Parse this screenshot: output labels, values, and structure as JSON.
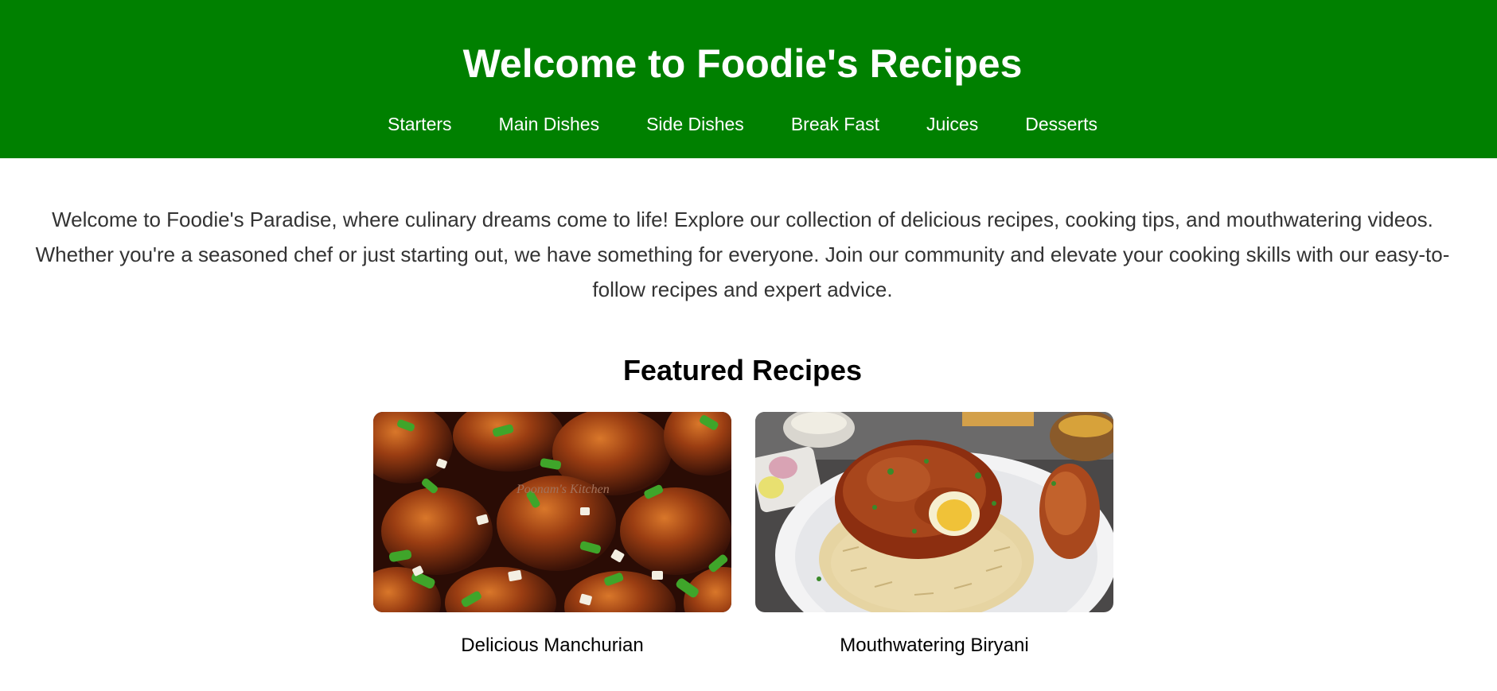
{
  "header": {
    "title": "Welcome to Foodie's Recipes",
    "background_color": "#008000",
    "nav": [
      {
        "label": "Starters"
      },
      {
        "label": "Main Dishes"
      },
      {
        "label": "Side Dishes"
      },
      {
        "label": "Break Fast"
      },
      {
        "label": "Juices"
      },
      {
        "label": "Desserts"
      }
    ]
  },
  "intro": {
    "text": "Welcome to Foodie's Paradise, where culinary dreams come to life! Explore our collection of delicious recipes, cooking tips, and mouthwatering videos. Whether you're a seasoned chef or just starting out, we have something for everyone. Join our community and elevate your cooking skills with our easy-to-follow recipes and expert advice."
  },
  "featured": {
    "title": "Featured Recipes",
    "recipes": [
      {
        "caption": "Delicious Manchurian",
        "image_watermark": "Poonam's Kitchen"
      },
      {
        "caption": "Mouthwatering Biryani"
      }
    ]
  }
}
